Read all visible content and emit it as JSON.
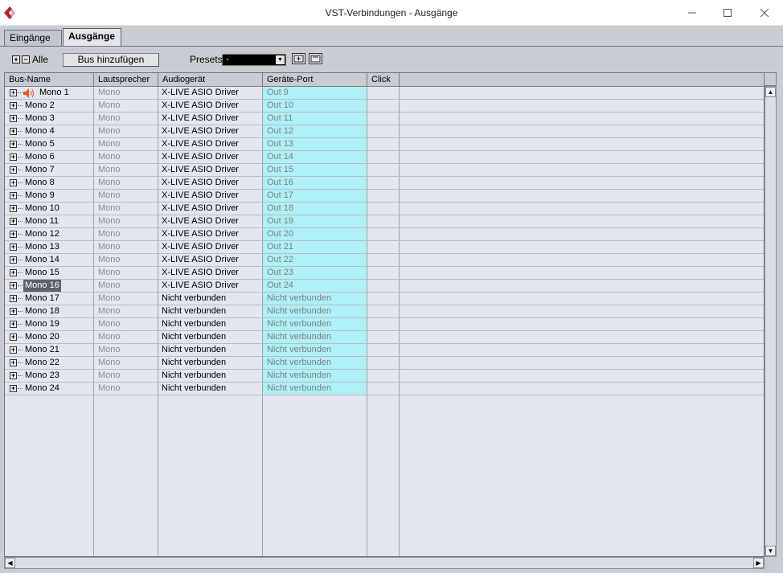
{
  "window": {
    "title": "VST-Verbindungen - Ausgänge",
    "minimize_label": "—",
    "maximize_label": "☐",
    "close_label": "✕"
  },
  "tabs": [
    {
      "label": "Eingänge",
      "active": false
    },
    {
      "label": "Ausgänge",
      "active": true
    }
  ],
  "toolbar": {
    "expand_all_symbol": "+",
    "collapse_all_symbol": "−",
    "all_label": "Alle",
    "add_bus_label": "Bus hinzufügen",
    "presets_label": "Presets",
    "preset_value": "-"
  },
  "columns": [
    "Bus-Name",
    "Lautsprecher",
    "Audiogerät",
    "Geräte-Port",
    "Click"
  ],
  "rows": [
    {
      "name": "Mono 1",
      "speaker": "Mono",
      "device": "X-LIVE ASIO Driver",
      "port": "Out 9"
    },
    {
      "name": "Mono 2",
      "speaker": "Mono",
      "device": "X-LIVE ASIO Driver",
      "port": "Out 10"
    },
    {
      "name": "Mono 3",
      "speaker": "Mono",
      "device": "X-LIVE ASIO Driver",
      "port": "Out 11"
    },
    {
      "name": "Mono 4",
      "speaker": "Mono",
      "device": "X-LIVE ASIO Driver",
      "port": "Out 12"
    },
    {
      "name": "Mono 5",
      "speaker": "Mono",
      "device": "X-LIVE ASIO Driver",
      "port": "Out 13"
    },
    {
      "name": "Mono 6",
      "speaker": "Mono",
      "device": "X-LIVE ASIO Driver",
      "port": "Out 14"
    },
    {
      "name": "Mono 7",
      "speaker": "Mono",
      "device": "X-LIVE ASIO Driver",
      "port": "Out 15"
    },
    {
      "name": "Mono 8",
      "speaker": "Mono",
      "device": "X-LIVE ASIO Driver",
      "port": "Out 16"
    },
    {
      "name": "Mono 9",
      "speaker": "Mono",
      "device": "X-LIVE ASIO Driver",
      "port": "Out 17"
    },
    {
      "name": "Mono 10",
      "speaker": "Mono",
      "device": "X-LIVE ASIO Driver",
      "port": "Out 18"
    },
    {
      "name": "Mono 11",
      "speaker": "Mono",
      "device": "X-LIVE ASIO Driver",
      "port": "Out 19"
    },
    {
      "name": "Mono 12",
      "speaker": "Mono",
      "device": "X-LIVE ASIO Driver",
      "port": "Out 20"
    },
    {
      "name": "Mono 13",
      "speaker": "Mono",
      "device": "X-LIVE ASIO Driver",
      "port": "Out 21"
    },
    {
      "name": "Mono 14",
      "speaker": "Mono",
      "device": "X-LIVE ASIO Driver",
      "port": "Out 22"
    },
    {
      "name": "Mono 15",
      "speaker": "Mono",
      "device": "X-LIVE ASIO Driver",
      "port": "Out 23"
    },
    {
      "name": "Mono 16",
      "speaker": "Mono",
      "device": "X-LIVE ASIO Driver",
      "port": "Out 24"
    },
    {
      "name": "Mono 17",
      "speaker": "Mono",
      "device": "Nicht verbunden",
      "port": "Nicht verbunden"
    },
    {
      "name": "Mono 18",
      "speaker": "Mono",
      "device": "Nicht verbunden",
      "port": "Nicht verbunden"
    },
    {
      "name": "Mono 19",
      "speaker": "Mono",
      "device": "Nicht verbunden",
      "port": "Nicht verbunden"
    },
    {
      "name": "Mono 20",
      "speaker": "Mono",
      "device": "Nicht verbunden",
      "port": "Nicht verbunden"
    },
    {
      "name": "Mono 21",
      "speaker": "Mono",
      "device": "Nicht verbunden",
      "port": "Nicht verbunden"
    },
    {
      "name": "Mono 22",
      "speaker": "Mono",
      "device": "Nicht verbunden",
      "port": "Nicht verbunden"
    },
    {
      "name": "Mono 23",
      "speaker": "Mono",
      "device": "Nicht verbunden",
      "port": "Nicht verbunden"
    },
    {
      "name": "Mono 24",
      "speaker": "Mono",
      "device": "Nicht verbunden",
      "port": "Nicht verbunden"
    }
  ],
  "selected_row": "Mono 16",
  "click_row": "Mono 1",
  "colors": {
    "port_column_bg": "#aef0f6",
    "selected_bg": "#5e6169",
    "speaker_icon": "#e05a2a",
    "logo": "#b3263a"
  },
  "icons": {
    "logo": "cubase-logo-icon",
    "click": "speaker-icon",
    "preset_store": "preset-store-icon",
    "preset_remove": "preset-remove-icon"
  }
}
